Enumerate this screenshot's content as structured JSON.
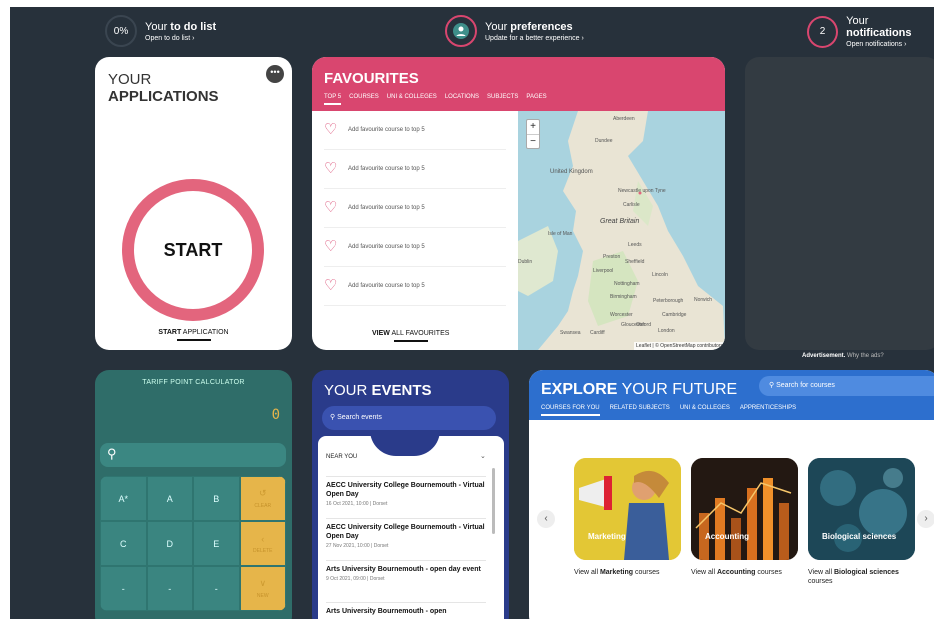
{
  "top": {
    "todo": {
      "badge": "0%",
      "prefix": "Your ",
      "strong": "to do list",
      "sub": "Open to do list ›"
    },
    "prefs": {
      "prefix": "Your ",
      "strong": "preferences",
      "sub": "Update for a better experience ›"
    },
    "notif": {
      "badge": "2",
      "prefix": "Your ",
      "strong": "notifications",
      "sub": "Open notifications ›"
    }
  },
  "applications": {
    "title_light": "YOUR",
    "title_bold": "APPLICATIONS",
    "start": "START",
    "link_bold": "START",
    "link_rest": " APPLICATION"
  },
  "favourites": {
    "title": "FAVOURITES",
    "tabs": [
      "TOP 5",
      "COURSES",
      "UNI & COLLEGES",
      "LOCATIONS",
      "SUBJECTS",
      "PAGES"
    ],
    "items": [
      "Add favourite course to top 5",
      "Add favourite course to top 5",
      "Add favourite course to top 5",
      "Add favourite course to top 5",
      "Add favourite course to top 5"
    ],
    "view_bold": "VIEW",
    "view_rest": " ALL FAVOURITES",
    "map_labels": [
      "Aberdeen",
      "Dundee",
      "United Kingdom",
      "Newcastle upon Tyne",
      "Carlisle",
      "Great Britain",
      "Isle of Man",
      "Leeds",
      "Dublin",
      "Preston",
      "Sheffield",
      "Liverpool",
      "Lincoln",
      "Nottingham",
      "Norwich",
      "Birmingham",
      "Peterborough",
      "Cambridge",
      "Worcester",
      "Swansea",
      "Cardiff",
      "Gloucester",
      "Oxford",
      "London"
    ],
    "attribution": "Leaflet | © OpenStreetMap contributors"
  },
  "advert": {
    "bold": "Advertisement.",
    "rest": " Why the ads?"
  },
  "tariff": {
    "title": "TARIFF POINT CALCULATOR",
    "value": "0",
    "keys": [
      {
        "label": "A*"
      },
      {
        "label": "A"
      },
      {
        "label": "B"
      },
      {
        "label": "↺",
        "small": "CLEAR"
      },
      {
        "label": "C"
      },
      {
        "label": "D"
      },
      {
        "label": "E"
      },
      {
        "label": "‹",
        "small": "DELETE"
      },
      {
        "label": "-"
      },
      {
        "label": "-"
      },
      {
        "label": "-"
      },
      {
        "label": "∨",
        "small": "NEW"
      }
    ]
  },
  "events": {
    "title_light": "YOUR ",
    "title_bold": "EVENTS",
    "search_placeholder": "Search events",
    "filter": "NEAR YOU",
    "items": [
      {
        "name": "AECC University College Bournemouth - Virtual Open Day",
        "date": "16 Oct 2021, 10:00 | Dorset"
      },
      {
        "name": "AECC University College Bournemouth - Virtual Open Day",
        "date": "27 Nov 2021, 10:00 | Dorset"
      },
      {
        "name": "Arts University Bournemouth - open day event",
        "date": "9 Oct 2021, 09:00 | Dorset"
      },
      {
        "name": "Arts University Bournemouth - open",
        "date": ""
      }
    ]
  },
  "explore": {
    "title_bold": "EXPLORE",
    "title_rest": " YOUR FUTURE",
    "search_placeholder": "Search for courses",
    "tabs": [
      "COURSES FOR YOU",
      "RELATED SUBJECTS",
      "UNI & COLLEGES",
      "APPRENTICESHIPS"
    ],
    "tiles": [
      {
        "name": "Marketing",
        "cap_pre": "View all ",
        "cap_bold": "Marketing",
        "cap_post": " courses"
      },
      {
        "name": "Accounting",
        "cap_pre": "View all ",
        "cap_bold": "Accounting",
        "cap_post": " courses"
      },
      {
        "name": "Biological sciences",
        "cap_pre": "View all ",
        "cap_bold": "Biological sciences",
        "cap_post": " courses"
      }
    ]
  },
  "colors": {
    "pink": "#d9466f",
    "navy": "#2a3b8a",
    "teal": "#2f6d69",
    "blue": "#2d6fce",
    "bg": "#27313b"
  }
}
